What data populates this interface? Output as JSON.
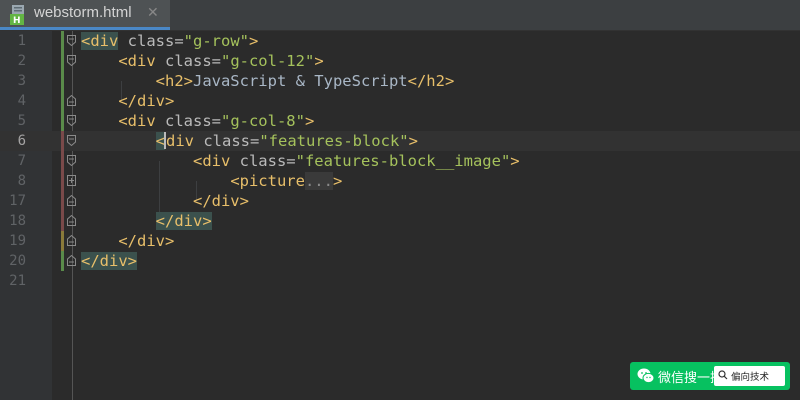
{
  "tab": {
    "filename": "webstorm.html",
    "close_glyph": "✕",
    "icon": "html-file-icon"
  },
  "lines": [
    {
      "n": "1"
    },
    {
      "n": "2"
    },
    {
      "n": "3"
    },
    {
      "n": "4"
    },
    {
      "n": "5"
    },
    {
      "n": "6"
    },
    {
      "n": "7"
    },
    {
      "n": "8"
    },
    {
      "n": "17"
    },
    {
      "n": "18"
    },
    {
      "n": "19"
    },
    {
      "n": "20"
    },
    {
      "n": "21"
    }
  ],
  "code": {
    "l1": {
      "open": "<div",
      "attr": " class=",
      "val": "\"g-row\"",
      "close": ">"
    },
    "l2": {
      "open": "<div",
      "attr": " class=",
      "val": "\"g-col-12\"",
      "close": ">"
    },
    "l3": {
      "open": "<h2>",
      "text": "JavaScript & TypeScript",
      "close": "</h2>"
    },
    "l4": {
      "close": "</div>"
    },
    "l5": {
      "open": "<div",
      "attr": " class=",
      "val": "\"g-col-8\"",
      "close": ">"
    },
    "l6": {
      "open": "<",
      "open2": "div",
      "attr": " class=",
      "val": "\"features-block\"",
      "close": ">"
    },
    "l7": {
      "open": "<div",
      "attr": " class=",
      "val": "\"features-block__image\"",
      "close": ">"
    },
    "l8": {
      "open": "<picture",
      "fold": "...",
      "close": ">"
    },
    "l17": {
      "close": "</div>"
    },
    "l18": {
      "close": "</div>"
    },
    "l19": {
      "close": "</div>"
    },
    "l20": {
      "close": "</div>"
    }
  },
  "watermark": {
    "label": "微信搜一搜",
    "search_value": "偏向技术"
  },
  "colors": {
    "tag": "#e8bf6a",
    "value": "#a5c25c",
    "bg": "#2b2b2b",
    "wechat": "#07c160"
  }
}
